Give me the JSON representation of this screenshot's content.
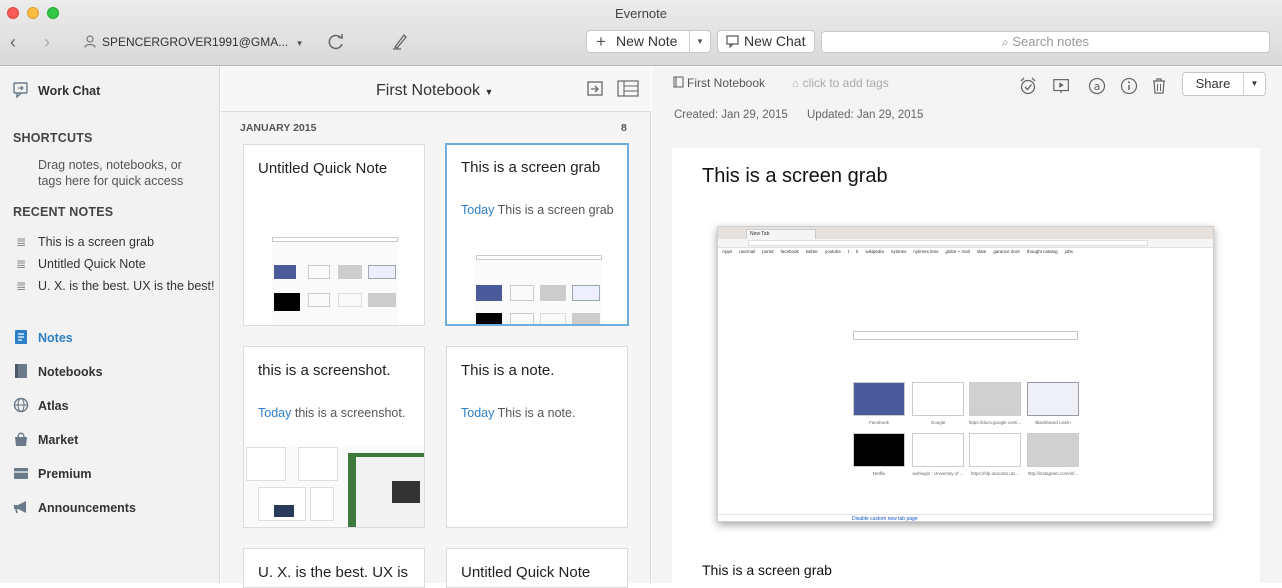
{
  "window": {
    "title": "Evernote"
  },
  "toolbar": {
    "account": "SPENCERGROVER1991@GMA...",
    "new_note": "New Note",
    "new_chat": "New Chat",
    "search_placeholder": "Search notes"
  },
  "sidebar": {
    "work_chat": "Work Chat",
    "shortcuts_heading": "SHORTCUTS",
    "shortcuts_hint": "Drag notes, notebooks, or tags here for quick access",
    "recent_heading": "RECENT NOTES",
    "recent": [
      "This is a screen grab",
      "Untitled Quick Note",
      "U. X. is the best. UX is the best!"
    ],
    "nav": [
      {
        "label": "Notes",
        "icon": "notes-icon",
        "active": true
      },
      {
        "label": "Notebooks",
        "icon": "notebook-icon"
      },
      {
        "label": "Atlas",
        "icon": "globe-icon"
      },
      {
        "label": "Market",
        "icon": "market-icon"
      },
      {
        "label": "Premium",
        "icon": "premium-icon"
      },
      {
        "label": "Announcements",
        "icon": "megaphone-icon"
      }
    ]
  },
  "list": {
    "notebook": "First Notebook",
    "section": "JANUARY 2015",
    "count": "8",
    "cards": [
      {
        "title": "Untitled Quick Note",
        "date": "",
        "snippet": ""
      },
      {
        "title": "This is a screen grab",
        "date": "Today",
        "snippet": "This is a screen grab"
      },
      {
        "title": "this is a screenshot.",
        "date": "Today",
        "snippet": "this is a screenshot."
      },
      {
        "title": "This is a note.",
        "date": "Today",
        "snippet": "This is a note."
      },
      {
        "title": "U. X. is the best. UX is",
        "date": "",
        "snippet": ""
      },
      {
        "title": "Untitled Quick Note",
        "date": "",
        "snippet": ""
      }
    ]
  },
  "note": {
    "notebook": "First Notebook",
    "tags_placeholder": "click to add tags",
    "share": "Share",
    "created": "Created: Jan 29, 2015",
    "updated": "Updated: Jan 29, 2015",
    "title": "This is a screen grab",
    "body": "This is a screen grab",
    "screenshot": {
      "tab": "New Tab",
      "bookmarks": [
        "Apps",
        "utormail",
        "portal",
        "facebook",
        "twitter",
        "youtube",
        "t",
        "k",
        "wikipedia",
        "nytimes",
        "nytimes lens",
        "globe + mail",
        "slate",
        "garance doré",
        "thought catalog",
        "jobs"
      ],
      "tiles": [
        "Facebook",
        "Google",
        "https://docs.google.com/...",
        "Blackboard Learn",
        "Netflix",
        "weblogin : University of ...",
        "https://sfp.utoronto.utc...",
        "http://instagram.com/inf..."
      ],
      "footer": "Disable custom new tab page"
    }
  }
}
